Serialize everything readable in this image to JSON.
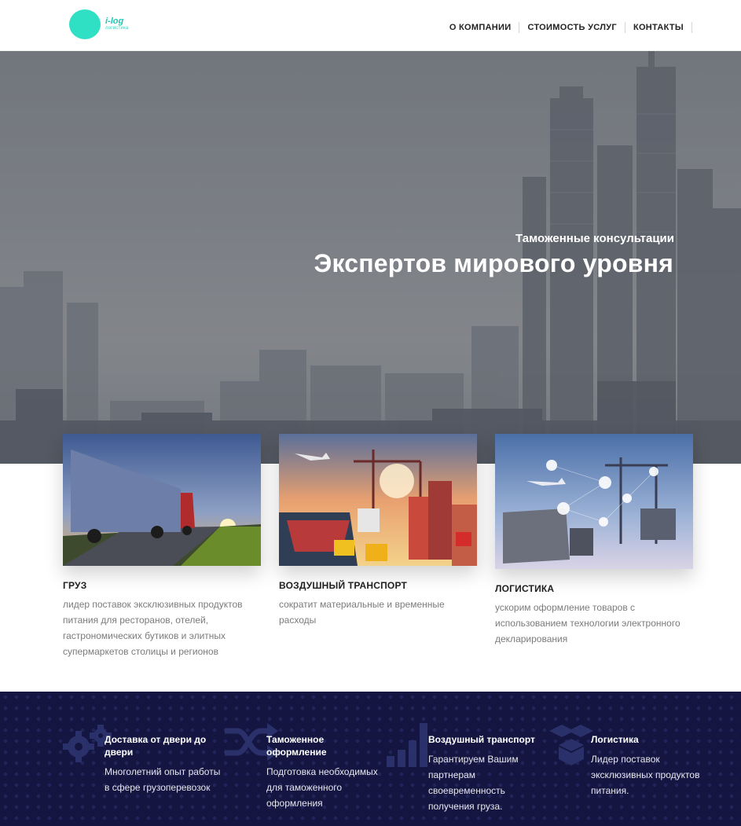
{
  "header": {
    "logo": {
      "name": "i-log",
      "sub": "логистика"
    },
    "nav": [
      {
        "label": "О КОМПАНИИ"
      },
      {
        "label": "СТОИМОСТЬ УСЛУГ"
      },
      {
        "label": "КОНТАКТЫ"
      }
    ]
  },
  "hero": {
    "subtitle": "Таможенные консультации",
    "title": "Экспертов мирового уровня"
  },
  "cards": [
    {
      "title": "ГРУЗ",
      "text": "лидер поставок эксклюзивных продуктов питания для ресторанов, отелей, гастрономических бутиков и элитных супермаркетов столицы и регионов"
    },
    {
      "title": "ВОЗДУШНЫЙ ТРАНСПОРТ",
      "text": "сократит материальные и временные расходы"
    },
    {
      "title": "ЛОГИСТИКА",
      "text": "ускорим оформление товаров с использованием технологии электронного декларирования"
    }
  ],
  "features": [
    {
      "icon": "gears-icon",
      "title": "Доставка от двери до двери",
      "text": "Многолетний опыт работы в сфере грузоперевозок"
    },
    {
      "icon": "shuffle-icon",
      "title": "Таможенное оформление",
      "text": "Подготовка необходимых для таможенного оформления"
    },
    {
      "icon": "bar-chart-icon",
      "title": "Воздушный транспорт",
      "text": "Гарантируем Вашим партнерам своевременность получения груза."
    },
    {
      "icon": "boxes-icon",
      "title": "Логистика",
      "text": "Лидер поставок эксклюзивных продуктов питания."
    }
  ],
  "colors": {
    "accent": "#2fe0c4",
    "band": "#141641"
  }
}
